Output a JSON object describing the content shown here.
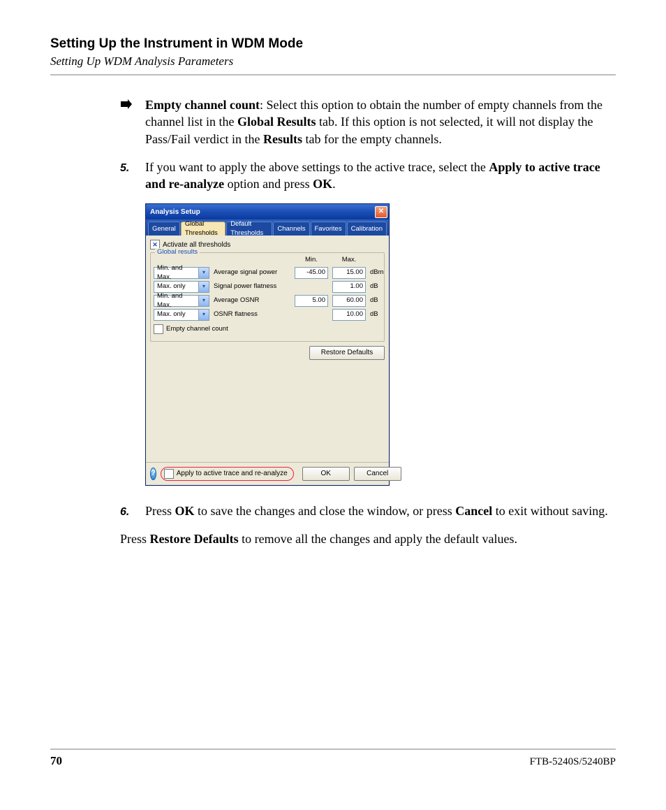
{
  "header": {
    "title": "Setting Up the Instrument in WDM Mode",
    "subtitle": "Setting Up WDM Analysis Parameters"
  },
  "bullet": {
    "lead": "Empty channel count",
    "text_1": ": Select this option to obtain the number of empty channels from the channel list in the ",
    "bold_1": "Global Results",
    "text_2": " tab. If this option is not selected, it will not display the Pass/Fail verdict in the ",
    "bold_2": "Results",
    "text_3": " tab for the empty channels."
  },
  "step5": {
    "num": "5.",
    "text_1": "If you want to apply the above settings to the active trace, select the ",
    "bold_1": "Apply to active trace and re-analyze",
    "text_2": " option and press ",
    "bold_2": "OK",
    "text_3": "."
  },
  "dialog": {
    "title": "Analysis Setup",
    "tabs": [
      "General",
      "Global Thresholds",
      "Default Thresholds",
      "Channels",
      "Favorites",
      "Calibration"
    ],
    "activate_label": "Activate all thresholds",
    "fieldset_legend": "Global results",
    "col_min": "Min.",
    "col_max": "Max.",
    "rows": [
      {
        "mode": "Min. and Max.",
        "label": "Average signal power",
        "min": "-45.00",
        "max": "15.00",
        "unit": "dBm"
      },
      {
        "mode": "Max. only",
        "label": "Signal power flatness",
        "min": "",
        "max": "1.00",
        "unit": "dB"
      },
      {
        "mode": "Min. and Max.",
        "label": "Average OSNR",
        "min": "5.00",
        "max": "60.00",
        "unit": "dB"
      },
      {
        "mode": "Max. only",
        "label": "OSNR flatness",
        "min": "",
        "max": "10.00",
        "unit": "dB"
      }
    ],
    "empty_label": "Empty channel count",
    "restore": "Restore Defaults",
    "apply_label": "Apply to active trace and re-analyze",
    "ok": "OK",
    "cancel": "Cancel"
  },
  "step6": {
    "num": "6.",
    "text_1": "Press ",
    "bold_1": "OK",
    "text_2": " to save the changes and close the window, or press ",
    "bold_2": "Cancel",
    "text_3": " to exit without saving."
  },
  "para": {
    "text_1": "Press ",
    "bold_1": "Restore Defaults",
    "text_2": " to remove all the changes and apply the default values."
  },
  "footer": {
    "page": "70",
    "product": "FTB-5240S/5240BP"
  }
}
